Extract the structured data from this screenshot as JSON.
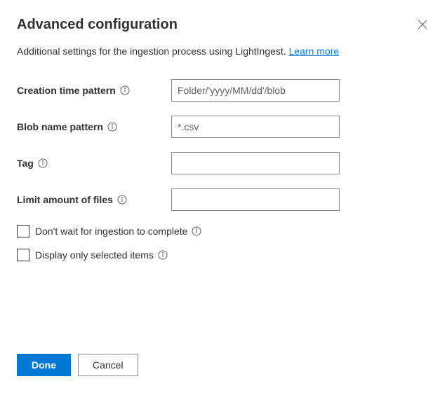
{
  "header": {
    "title": "Advanced configuration"
  },
  "description": {
    "text": "Additional settings for the ingestion process using LightIngest. ",
    "link": "Learn more"
  },
  "fields": {
    "creation_time": {
      "label": "Creation time pattern",
      "placeholder": "Folder/'yyyy/MM/dd'/blob",
      "value": ""
    },
    "blob_name": {
      "label": "Blob name pattern",
      "placeholder": "*.csv",
      "value": ""
    },
    "tag": {
      "label": "Tag",
      "placeholder": "",
      "value": ""
    },
    "limit_files": {
      "label": "Limit amount of files",
      "placeholder": "",
      "value": ""
    }
  },
  "checkboxes": {
    "dont_wait": {
      "label": "Don't wait for ingestion to complete"
    },
    "display_selected": {
      "label": "Display only selected items"
    }
  },
  "footer": {
    "done": "Done",
    "cancel": "Cancel"
  }
}
